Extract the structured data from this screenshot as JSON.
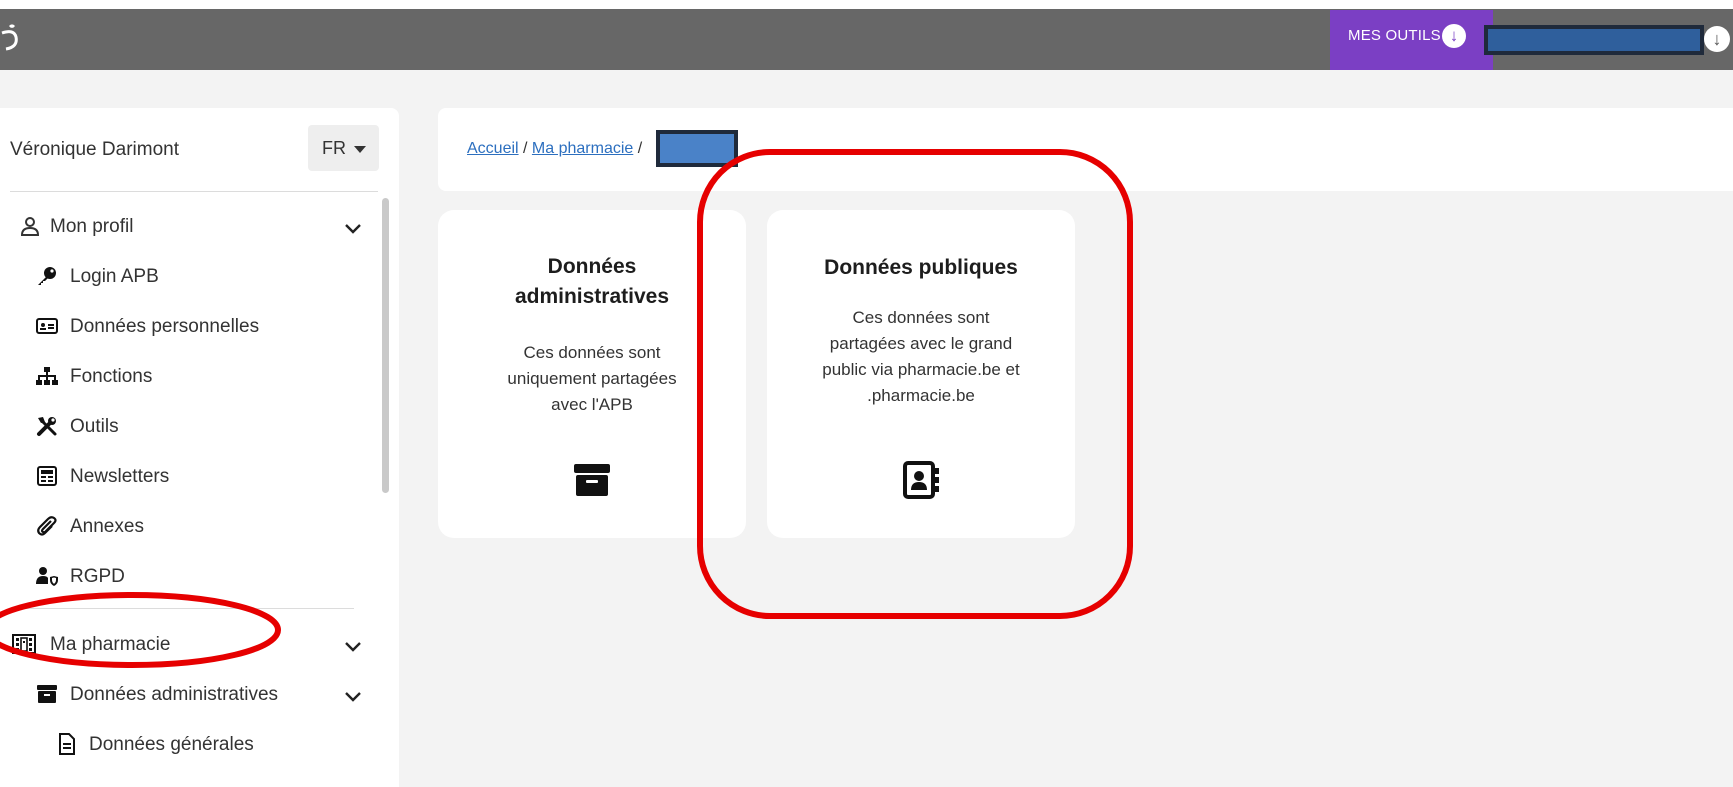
{
  "header": {
    "tools_label": "MES OUTILS",
    "tools_icon": "arrow-down-circle-icon",
    "user_icon": "arrow-down-circle-icon"
  },
  "sidebar": {
    "user_name": "Véronique Darimont",
    "language": "FR",
    "profile_section": {
      "label": "Mon profil",
      "items": [
        {
          "label": "Login APB",
          "icon": "key-icon"
        },
        {
          "label": "Données personnelles",
          "icon": "id-card-icon"
        },
        {
          "label": "Fonctions",
          "icon": "sitemap-icon"
        },
        {
          "label": "Outils",
          "icon": "tools-icon"
        },
        {
          "label": "Newsletters",
          "icon": "newspaper-icon"
        },
        {
          "label": "Annexes",
          "icon": "paperclip-icon"
        },
        {
          "label": "RGPD",
          "icon": "user-shield-icon"
        }
      ]
    },
    "pharmacy_section": {
      "label": "Ma pharmacie",
      "sub_label": "Données administratives",
      "sub_items": [
        {
          "label": "Données générales",
          "icon": "file-icon"
        }
      ]
    }
  },
  "breadcrumb": {
    "home": "Accueil",
    "sep1": " / ",
    "pharmacy": "Ma pharmacie",
    "sep2": " /"
  },
  "cards": [
    {
      "title_line1": "Données",
      "title_line2": "administratives",
      "desc_lines": [
        "Ces données sont",
        "uniquement partagées",
        "avec l'APB"
      ],
      "icon": "archive-icon"
    },
    {
      "title_line1": "Données publiques",
      "desc_lines": [
        "Ces données sont",
        "partagées avec le grand",
        "public via pharmacie.be et",
        ".pharmacie.be"
      ],
      "icon": "address-book-icon"
    }
  ],
  "colors": {
    "topbar": "#676767",
    "accent_purple": "#7b3fc4",
    "link_blue": "#2c6fbf",
    "annotation_red": "#e60000",
    "background": "#f3f3f3"
  }
}
